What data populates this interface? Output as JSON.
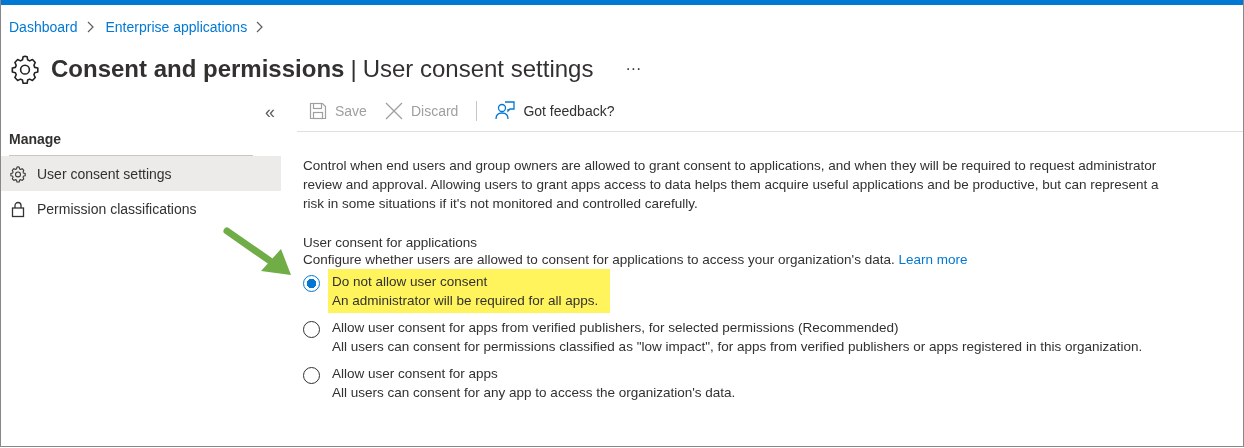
{
  "breadcrumb": [
    {
      "label": "Dashboard"
    },
    {
      "label": "Enterprise applications"
    }
  ],
  "header": {
    "title": "Consent and permissions",
    "separator": "|",
    "subtitle": "User consent settings",
    "more": "···"
  },
  "sidebar": {
    "collapse": "«",
    "section": "Manage",
    "items": [
      {
        "label": "User consent settings",
        "kind": "gear",
        "selected": true
      },
      {
        "label": "Permission classifications",
        "kind": "lock",
        "selected": false
      }
    ]
  },
  "toolbar": [
    {
      "label": "Save",
      "kind": "save",
      "disabled": true
    },
    {
      "label": "Discard",
      "kind": "discard",
      "disabled": true
    },
    {
      "label": "Got feedback?",
      "kind": "feedback",
      "disabled": false
    }
  ],
  "description": "Control when end users and group owners are allowed to grant consent to applications, and when they will be required to request administrator review and approval. Allowing users to grant apps access to data helps them acquire useful applications and be productive, but can represent a risk in some situations if it's not monitored and controlled carefully.",
  "consent": {
    "title": "User consent for applications",
    "hint": "Configure whether users are allowed to consent for applications to access your organization's data.",
    "link": "Learn more",
    "options": [
      {
        "label": "Do not allow user consent",
        "detail": "An administrator will be required for all apps.",
        "selected": true,
        "highlighted": true
      },
      {
        "label": "Allow user consent for apps from verified publishers, for selected permissions (Recommended)",
        "detail": "All users can consent for permissions classified as \"low impact\", for apps from verified publishers or apps registered in this organization.",
        "selected": false,
        "highlighted": false
      },
      {
        "label": "Allow user consent for apps",
        "detail": "All users can consent for any app to access the organization's data.",
        "selected": false,
        "highlighted": false
      }
    ]
  }
}
